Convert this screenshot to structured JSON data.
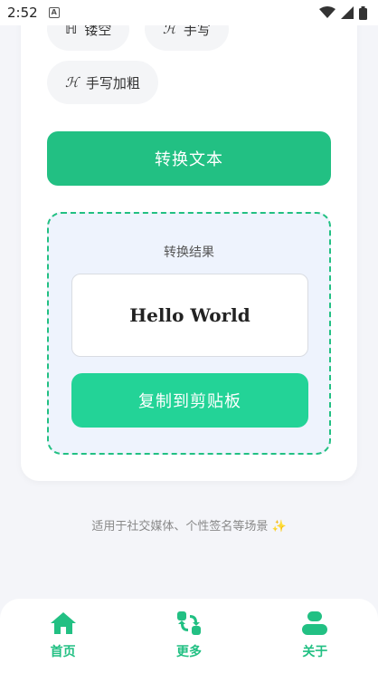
{
  "status_bar": {
    "time": "2:52",
    "notification_badge": "A"
  },
  "styles": [
    {
      "icon": "ℍ",
      "label": "镂空"
    },
    {
      "icon": "ℋ",
      "label": "手写"
    },
    {
      "icon": "ℋ",
      "label": "手写加粗"
    }
  ],
  "convert_button": "转换文本",
  "result": {
    "title": "转换结果",
    "text": "Hello World",
    "copy_button": "复制到剪贴板"
  },
  "footnote": "适用于社交媒体、个性签名等场景 ✨",
  "nav": [
    {
      "label": "首页",
      "icon": "home-icon"
    },
    {
      "label": "更多",
      "icon": "convert-icon"
    },
    {
      "label": "关于",
      "icon": "user-icon"
    }
  ],
  "colors": {
    "accent": "#22c083",
    "copy": "#23d397",
    "result_bg": "#eef3fd"
  }
}
